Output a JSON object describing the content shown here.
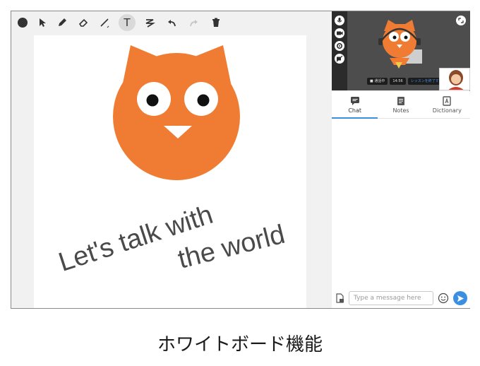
{
  "whiteboard": {
    "text_line1": "Let's talk with",
    "text_line2": "the world"
  },
  "toolbar": {
    "tools": [
      "color-picker",
      "select",
      "pen",
      "eraser",
      "line",
      "text",
      "shape",
      "undo",
      "redo",
      "delete"
    ],
    "active_tool": "text",
    "text_tool_label": "T"
  },
  "video": {
    "status_items": [
      "■ 通話中",
      "14:56",
      "レッスンを終了する"
    ]
  },
  "tabs": [
    {
      "label": "Chat",
      "active": true
    },
    {
      "label": "Notes",
      "active": false
    },
    {
      "label": "Dictionary",
      "active": false
    }
  ],
  "composer": {
    "placeholder": "Type a message here"
  },
  "caption": "ホワイトボード機能",
  "colors": {
    "owl_orange": "#ef7c32",
    "accent_blue": "#3b8fe0",
    "video_bg": "#4d4d4d"
  }
}
